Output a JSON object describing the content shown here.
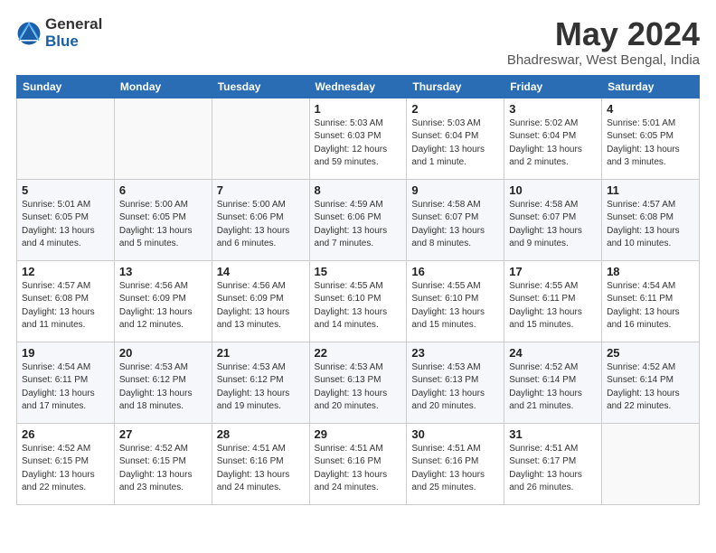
{
  "logo": {
    "general": "General",
    "blue": "Blue"
  },
  "title": "May 2024",
  "subtitle": "Bhadreswar, West Bengal, India",
  "days_header": [
    "Sunday",
    "Monday",
    "Tuesday",
    "Wednesday",
    "Thursday",
    "Friday",
    "Saturday"
  ],
  "weeks": [
    [
      {
        "day": "",
        "info": ""
      },
      {
        "day": "",
        "info": ""
      },
      {
        "day": "",
        "info": ""
      },
      {
        "day": "1",
        "info": "Sunrise: 5:03 AM\nSunset: 6:03 PM\nDaylight: 12 hours\nand 59 minutes."
      },
      {
        "day": "2",
        "info": "Sunrise: 5:03 AM\nSunset: 6:04 PM\nDaylight: 13 hours\nand 1 minute."
      },
      {
        "day": "3",
        "info": "Sunrise: 5:02 AM\nSunset: 6:04 PM\nDaylight: 13 hours\nand 2 minutes."
      },
      {
        "day": "4",
        "info": "Sunrise: 5:01 AM\nSunset: 6:05 PM\nDaylight: 13 hours\nand 3 minutes."
      }
    ],
    [
      {
        "day": "5",
        "info": "Sunrise: 5:01 AM\nSunset: 6:05 PM\nDaylight: 13 hours\nand 4 minutes."
      },
      {
        "day": "6",
        "info": "Sunrise: 5:00 AM\nSunset: 6:05 PM\nDaylight: 13 hours\nand 5 minutes."
      },
      {
        "day": "7",
        "info": "Sunrise: 5:00 AM\nSunset: 6:06 PM\nDaylight: 13 hours\nand 6 minutes."
      },
      {
        "day": "8",
        "info": "Sunrise: 4:59 AM\nSunset: 6:06 PM\nDaylight: 13 hours\nand 7 minutes."
      },
      {
        "day": "9",
        "info": "Sunrise: 4:58 AM\nSunset: 6:07 PM\nDaylight: 13 hours\nand 8 minutes."
      },
      {
        "day": "10",
        "info": "Sunrise: 4:58 AM\nSunset: 6:07 PM\nDaylight: 13 hours\nand 9 minutes."
      },
      {
        "day": "11",
        "info": "Sunrise: 4:57 AM\nSunset: 6:08 PM\nDaylight: 13 hours\nand 10 minutes."
      }
    ],
    [
      {
        "day": "12",
        "info": "Sunrise: 4:57 AM\nSunset: 6:08 PM\nDaylight: 13 hours\nand 11 minutes."
      },
      {
        "day": "13",
        "info": "Sunrise: 4:56 AM\nSunset: 6:09 PM\nDaylight: 13 hours\nand 12 minutes."
      },
      {
        "day": "14",
        "info": "Sunrise: 4:56 AM\nSunset: 6:09 PM\nDaylight: 13 hours\nand 13 minutes."
      },
      {
        "day": "15",
        "info": "Sunrise: 4:55 AM\nSunset: 6:10 PM\nDaylight: 13 hours\nand 14 minutes."
      },
      {
        "day": "16",
        "info": "Sunrise: 4:55 AM\nSunset: 6:10 PM\nDaylight: 13 hours\nand 15 minutes."
      },
      {
        "day": "17",
        "info": "Sunrise: 4:55 AM\nSunset: 6:11 PM\nDaylight: 13 hours\nand 15 minutes."
      },
      {
        "day": "18",
        "info": "Sunrise: 4:54 AM\nSunset: 6:11 PM\nDaylight: 13 hours\nand 16 minutes."
      }
    ],
    [
      {
        "day": "19",
        "info": "Sunrise: 4:54 AM\nSunset: 6:11 PM\nDaylight: 13 hours\nand 17 minutes."
      },
      {
        "day": "20",
        "info": "Sunrise: 4:53 AM\nSunset: 6:12 PM\nDaylight: 13 hours\nand 18 minutes."
      },
      {
        "day": "21",
        "info": "Sunrise: 4:53 AM\nSunset: 6:12 PM\nDaylight: 13 hours\nand 19 minutes."
      },
      {
        "day": "22",
        "info": "Sunrise: 4:53 AM\nSunset: 6:13 PM\nDaylight: 13 hours\nand 20 minutes."
      },
      {
        "day": "23",
        "info": "Sunrise: 4:53 AM\nSunset: 6:13 PM\nDaylight: 13 hours\nand 20 minutes."
      },
      {
        "day": "24",
        "info": "Sunrise: 4:52 AM\nSunset: 6:14 PM\nDaylight: 13 hours\nand 21 minutes."
      },
      {
        "day": "25",
        "info": "Sunrise: 4:52 AM\nSunset: 6:14 PM\nDaylight: 13 hours\nand 22 minutes."
      }
    ],
    [
      {
        "day": "26",
        "info": "Sunrise: 4:52 AM\nSunset: 6:15 PM\nDaylight: 13 hours\nand 22 minutes."
      },
      {
        "day": "27",
        "info": "Sunrise: 4:52 AM\nSunset: 6:15 PM\nDaylight: 13 hours\nand 23 minutes."
      },
      {
        "day": "28",
        "info": "Sunrise: 4:51 AM\nSunset: 6:16 PM\nDaylight: 13 hours\nand 24 minutes."
      },
      {
        "day": "29",
        "info": "Sunrise: 4:51 AM\nSunset: 6:16 PM\nDaylight: 13 hours\nand 24 minutes."
      },
      {
        "day": "30",
        "info": "Sunrise: 4:51 AM\nSunset: 6:16 PM\nDaylight: 13 hours\nand 25 minutes."
      },
      {
        "day": "31",
        "info": "Sunrise: 4:51 AM\nSunset: 6:17 PM\nDaylight: 13 hours\nand 26 minutes."
      },
      {
        "day": "",
        "info": ""
      }
    ]
  ]
}
